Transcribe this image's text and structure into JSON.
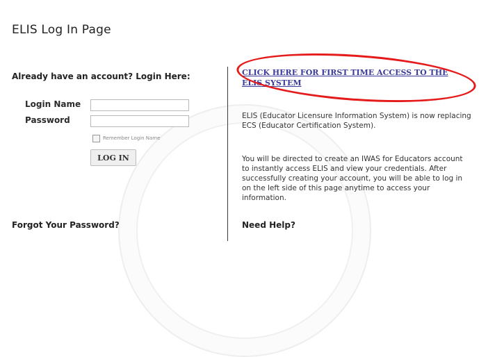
{
  "page": {
    "title": "ELIS Log In Page"
  },
  "login": {
    "heading": "Already have an account?  Login Here:",
    "login_name_label": "Login Name",
    "password_label": "Password",
    "login_name_value": "",
    "password_value": "",
    "remember_label": "Remember Login Name",
    "button_label": "LOG IN",
    "forgot_label": "Forgot Your Password?"
  },
  "first_time": {
    "link_text": "CLICK HERE FOR FIRST TIME ACCESS TO THE ELIS SYSTEM",
    "paragraph_1": "ELIS (Educator Licensure Information System) is now replacing ECS (Educator Certification System).",
    "paragraph_2": "You will be directed to create an IWAS for Educators account to instantly access ELIS and view your credentials. After successfully creating your account, you will be able to log in on the left side of this page anytime to access your information.",
    "help_heading": "Need Help?"
  },
  "colors": {
    "link": "#3b3b9a",
    "annotation": "#e51b1b",
    "text": "#2a2a2a"
  }
}
